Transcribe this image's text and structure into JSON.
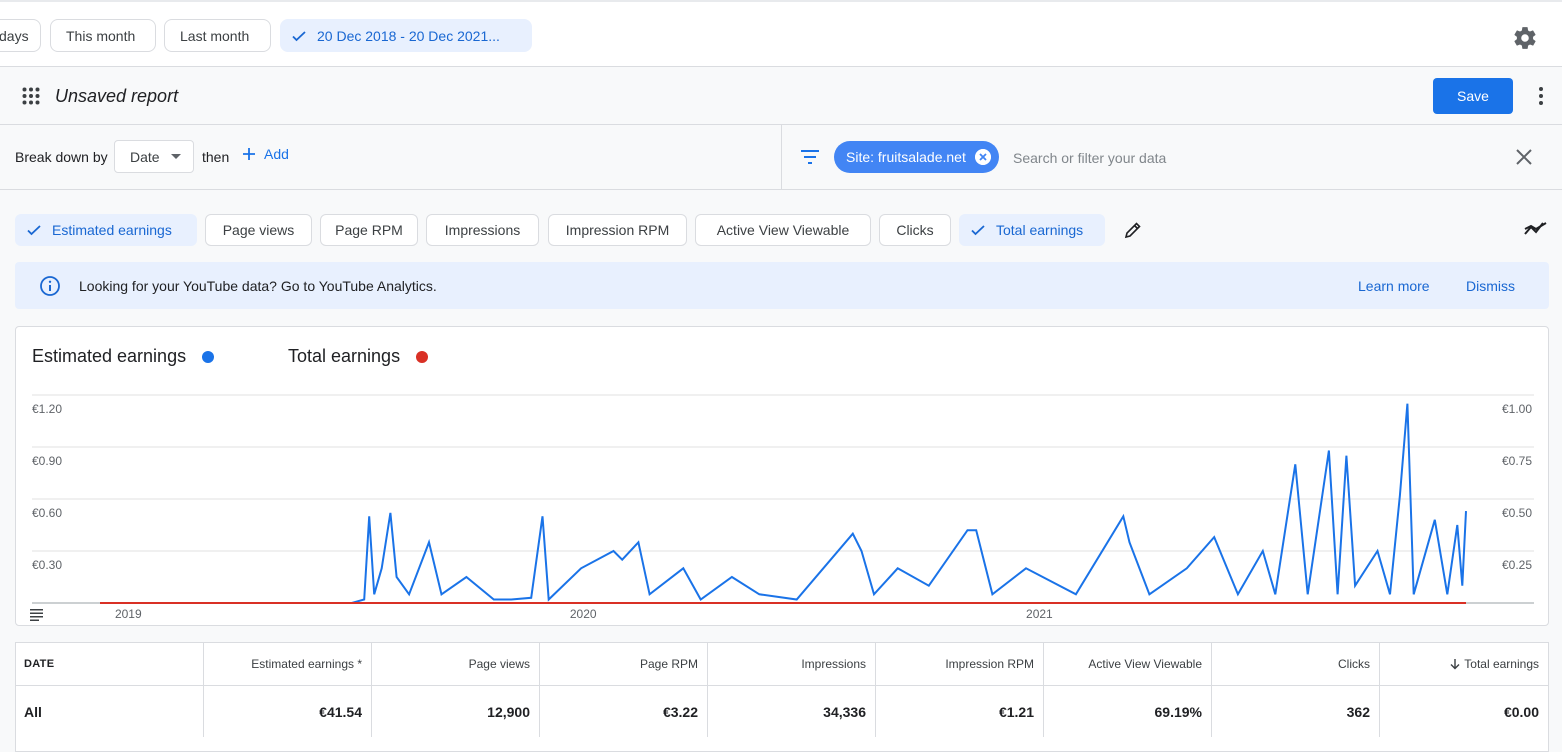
{
  "date_range": {
    "chips": [
      "days",
      "This month",
      "Last month"
    ],
    "selected": "20 Dec 2018 - 20 Dec 2021..."
  },
  "report": {
    "title": "Unsaved report",
    "save_label": "Save"
  },
  "breakdown": {
    "label": "Break down by",
    "value": "Date",
    "then": "then",
    "add_label": "Add"
  },
  "filter": {
    "chip": "Site: fruitsalade.net",
    "placeholder": "Search or filter your data"
  },
  "metrics": [
    {
      "label": "Estimated earnings",
      "selected": true
    },
    {
      "label": "Page views",
      "selected": false
    },
    {
      "label": "Page RPM",
      "selected": false
    },
    {
      "label": "Impressions",
      "selected": false
    },
    {
      "label": "Impression RPM",
      "selected": false
    },
    {
      "label": "Active View Viewable",
      "selected": false
    },
    {
      "label": "Clicks",
      "selected": false
    },
    {
      "label": "Total earnings",
      "selected": true
    }
  ],
  "banner": {
    "message": "Looking for your YouTube data? Go to YouTube Analytics.",
    "learn_more": "Learn more",
    "dismiss": "Dismiss"
  },
  "colors": {
    "accent": "#1a73e8",
    "estimated": "#1a73e8",
    "total": "#d93025"
  },
  "chart_data": {
    "type": "line",
    "legend": [
      "Estimated earnings",
      "Total earnings"
    ],
    "y_left_ticks": [
      "€1.20",
      "€0.90",
      "€0.60",
      "€0.30"
    ],
    "y_right_ticks": [
      "€1.00",
      "€0.75",
      "€0.50",
      "€0.25"
    ],
    "ylim_left": [
      0,
      1.2
    ],
    "ylim_right": [
      0,
      1.0
    ],
    "x_ticks": [
      "2019",
      "2020",
      "2021"
    ],
    "x_range": [
      "2018-12-20",
      "2021-12-20"
    ],
    "series": [
      {
        "name": "Estimated earnings",
        "axis": "left",
        "points": [
          [
            "2018-12-20",
            0
          ],
          [
            "2019-07-10",
            0
          ],
          [
            "2019-07-20",
            0.02
          ],
          [
            "2019-07-24",
            0.5
          ],
          [
            "2019-07-28",
            0.05
          ],
          [
            "2019-08-03",
            0.2
          ],
          [
            "2019-08-10",
            0.52
          ],
          [
            "2019-08-15",
            0.15
          ],
          [
            "2019-08-25",
            0.05
          ],
          [
            "2019-09-10",
            0.35
          ],
          [
            "2019-09-20",
            0.05
          ],
          [
            "2019-10-10",
            0.15
          ],
          [
            "2019-11-01",
            0.02
          ],
          [
            "2019-11-15",
            0.02
          ],
          [
            "2019-12-01",
            0.03
          ],
          [
            "2019-12-10",
            0.5
          ],
          [
            "2019-12-15",
            0.02
          ],
          [
            "2020-01-10",
            0.2
          ],
          [
            "2020-02-05",
            0.3
          ],
          [
            "2020-02-12",
            0.25
          ],
          [
            "2020-02-25",
            0.35
          ],
          [
            "2020-03-05",
            0.05
          ],
          [
            "2020-04-01",
            0.2
          ],
          [
            "2020-04-15",
            0.02
          ],
          [
            "2020-05-10",
            0.15
          ],
          [
            "2020-06-01",
            0.05
          ],
          [
            "2020-07-01",
            0.02
          ],
          [
            "2020-08-15",
            0.4
          ],
          [
            "2020-08-22",
            0.3
          ],
          [
            "2020-09-01",
            0.05
          ],
          [
            "2020-09-20",
            0.2
          ],
          [
            "2020-10-15",
            0.1
          ],
          [
            "2020-11-15",
            0.42
          ],
          [
            "2020-11-22",
            0.42
          ],
          [
            "2020-12-05",
            0.05
          ],
          [
            "2021-01-01",
            0.2
          ],
          [
            "2021-02-10",
            0.05
          ],
          [
            "2021-03-20",
            0.5
          ],
          [
            "2021-03-25",
            0.35
          ],
          [
            "2021-04-10",
            0.05
          ],
          [
            "2021-05-10",
            0.2
          ],
          [
            "2021-06-01",
            0.38
          ],
          [
            "2021-06-20",
            0.05
          ],
          [
            "2021-07-10",
            0.3
          ],
          [
            "2021-07-20",
            0.05
          ],
          [
            "2021-08-05",
            0.8
          ],
          [
            "2021-08-15",
            0.05
          ],
          [
            "2021-09-01",
            0.88
          ],
          [
            "2021-09-08",
            0.05
          ],
          [
            "2021-09-15",
            0.85
          ],
          [
            "2021-09-22",
            0.1
          ],
          [
            "2021-10-10",
            0.3
          ],
          [
            "2021-10-20",
            0.05
          ],
          [
            "2021-10-28",
            0.62
          ],
          [
            "2021-11-03",
            1.15
          ],
          [
            "2021-11-08",
            0.05
          ],
          [
            "2021-11-25",
            0.48
          ],
          [
            "2021-12-05",
            0.05
          ],
          [
            "2021-12-13",
            0.45
          ],
          [
            "2021-12-17",
            0.1
          ],
          [
            "2021-12-20",
            0.53
          ]
        ]
      },
      {
        "name": "Total earnings",
        "axis": "right",
        "points": [
          [
            "2018-12-20",
            0
          ],
          [
            "2021-12-20",
            0
          ]
        ]
      }
    ]
  },
  "table": {
    "headers": [
      "DATE",
      "Estimated earnings *",
      "Page views",
      "Page RPM",
      "Impressions",
      "Impression RPM",
      "Active View Viewable",
      "Clicks",
      "Total earnings"
    ],
    "rows": [
      [
        "All",
        "€41.54",
        "12,900",
        "€3.22",
        "34,336",
        "€1.21",
        "69.19%",
        "362",
        "€0.00"
      ]
    ]
  }
}
